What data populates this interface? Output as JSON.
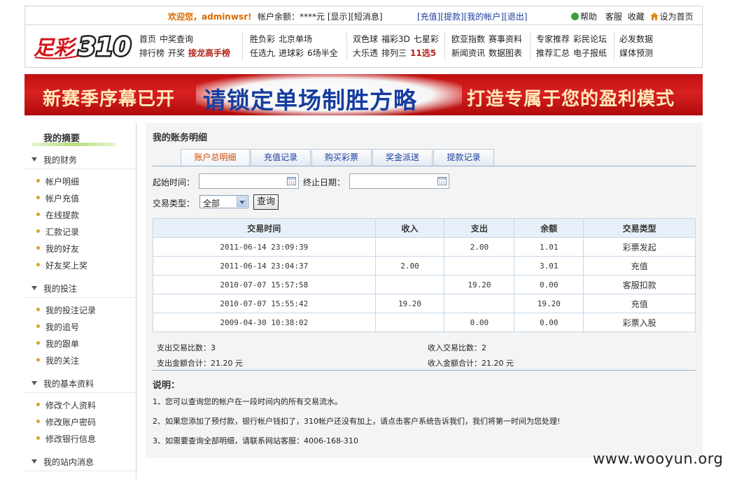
{
  "topbar": {
    "welcome": "欢迎您，adminwsr!",
    "balance_label": "帐户余额：",
    "balance_value": "****元",
    "show_link": "[显示]",
    "messages_link": "[短消息]",
    "account_links": [
      "[充值]",
      "[提款]",
      "[我的帐户]",
      "[退出]"
    ],
    "help_links": [
      "帮助",
      "客服",
      "收藏",
      "设为首页"
    ]
  },
  "logo": {
    "text": "足彩310"
  },
  "nav": {
    "col1": [
      [
        "首页",
        "中奖查询"
      ],
      [
        "排行榜",
        "开奖",
        "接龙高手榜"
      ]
    ],
    "col2": [
      [
        "胜负彩",
        "北京单场"
      ],
      [
        "任选九",
        "进球彩",
        "6场半全"
      ]
    ],
    "col3": [
      [
        "双色球",
        "福彩3D",
        "七星彩"
      ],
      [
        "大乐透",
        "排列三",
        "11选5"
      ]
    ],
    "col4": [
      [
        "欧亚指数",
        "赛事资料"
      ],
      [
        "新闻资讯",
        "数据图表"
      ]
    ],
    "col5": [
      [
        "专家推荐",
        "彩民论坛"
      ],
      [
        "推荐汇总",
        "电子报纸"
      ]
    ],
    "col6": [
      [
        "必发数据"
      ],
      [
        "媒体预测"
      ]
    ]
  },
  "banner": {
    "text1": "新赛季序幕已开",
    "text2": "请锁定单场制胜方略",
    "text3": "打造专属于您的盈利模式"
  },
  "sidebar": {
    "title": "我的摘要",
    "sections": [
      {
        "label": "我的财务",
        "items": [
          "帐户明细",
          "帐户充值",
          "在线提款",
          "汇款记录",
          "我的好友",
          "好友奖上奖"
        ]
      },
      {
        "label": "我的投注",
        "items": [
          "我的投注记录",
          "我的追号",
          "我的跟单",
          "我的关注"
        ]
      },
      {
        "label": "我的基本资料",
        "items": [
          "修改个人资料",
          "修改账户密码",
          "修改银行信息"
        ]
      },
      {
        "label": "我的站内消息",
        "items": []
      }
    ]
  },
  "main": {
    "title": "我的账务明细",
    "tabs": [
      "账户总明细",
      "充值记录",
      "购买彩票",
      "奖金派送",
      "提款记录"
    ],
    "active_tab": 0,
    "filters": {
      "start_label": "起始时间：",
      "start_value": "",
      "end_label": "终止日期：",
      "end_value": "",
      "type_label": "交易类型：",
      "type_value": "全部",
      "query_button": "查询"
    },
    "table": {
      "headers": [
        "交易时间",
        "收入",
        "支出",
        "余额",
        "交易类型"
      ],
      "rows": [
        [
          "2011-06-14 23:09:39",
          "",
          "2.00",
          "1.01",
          "彩票发起"
        ],
        [
          "2011-06-14 23:04:37",
          "2.00",
          "",
          "3.01",
          "充值"
        ],
        [
          "2010-07-07 15:57:58",
          "",
          "19.20",
          "0.00",
          "客服扣款"
        ],
        [
          "2010-07-07 15:55:42",
          "19.20",
          "",
          "19.20",
          "充值"
        ],
        [
          "2009-04-30 10:38:02",
          "",
          "0.00",
          "0.00",
          "彩票入股"
        ]
      ]
    },
    "summary": {
      "out_count": "支出交易比数：3",
      "in_count": "收入交易比数：2",
      "out_total": "支出金额合计：21.20 元",
      "in_total": "收入金额合计：21.20 元"
    },
    "notes": {
      "title": "说明：",
      "items": [
        "1、您可以查询您的帐户在一段时间内的所有交易流水。",
        "2、如果您添加了预付款，银行帐户钱扣了，310帐户还没有加上，请点击客户系统告诉我们，我们将第一时间为您处理!",
        "3、如需要查询全部明细，请联系网站客服：4006-168-310"
      ]
    }
  },
  "watermark": "www.wooyun.org",
  "colors": {
    "accent_red": "#c01010",
    "link_blue": "#1a3c9c",
    "tab_active": "#d24a00",
    "sidebar_dot": "#e0a020"
  }
}
